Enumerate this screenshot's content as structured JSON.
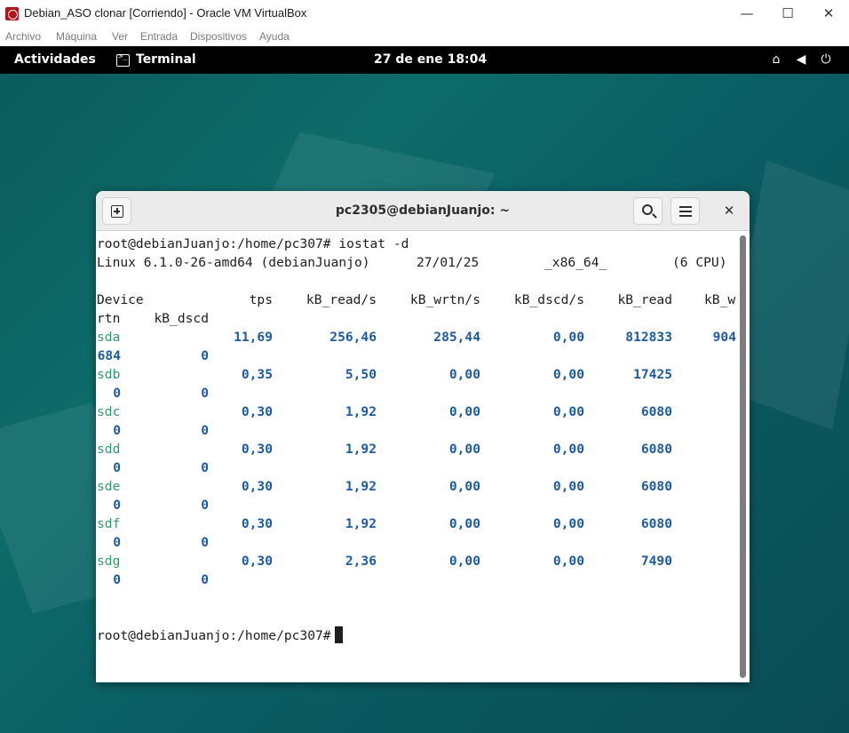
{
  "host_window": {
    "title": "Debian_ASO clonar [Corriendo] - Oracle VM VirtualBox",
    "app_icon": "virtualbox-icon",
    "controls": {
      "minimize": "—",
      "maximize": "☐",
      "close": "✕"
    },
    "menu": [
      "Archivo",
      "Máquina",
      "Ver",
      "Entrada",
      "Dispositivos",
      "Ayuda"
    ]
  },
  "gnome_bar": {
    "activities": "Actividades",
    "app_name": "Terminal",
    "clock": "27 de ene  18:04",
    "tray_icons": [
      "network-wired-icon",
      "volume-icon",
      "power-icon"
    ]
  },
  "terminal": {
    "title": "pc2305@debianJuanjo: ~",
    "icons": {
      "new_tab": "new-tab-icon",
      "search": "search-icon",
      "menu": "hamburger-menu-icon",
      "close": "close-icon"
    },
    "close_glyph": "✕",
    "command_line": "root@debianJuanjo:/home/pc307# iostat -d",
    "sysinfo": {
      "kernel": "Linux 6.1.0-26-amd64 (debianJuanjo)",
      "date": "27/01/25",
      "arch": "_x86_64_",
      "cpus": "(6 CPU)"
    },
    "header": {
      "device": "Device",
      "tps": "tps",
      "read_s": "kB_read/s",
      "wrtn_s": "kB_wrtn/s",
      "dscd_s": "kB_dscd/s",
      "read": "kB_read",
      "wrtn_cut": "kB_w",
      "wrtn_rest": "rtn",
      "dscd": "kB_dscd"
    },
    "rows": [
      {
        "device": "sda",
        "tps": "11,69",
        "read_s": "256,46",
        "wrtn_s": "285,44",
        "dscd_s": "0,00",
        "read": "812833",
        "wrtn_cut": "904",
        "wrtn_rest": "684",
        "dscd": "0"
      },
      {
        "device": "sdb",
        "tps": "0,35",
        "read_s": "5,50",
        "wrtn_s": "0,00",
        "dscd_s": "0,00",
        "read": "17425",
        "wrtn_cut": "",
        "wrtn_rest": "0",
        "dscd": "0"
      },
      {
        "device": "sdc",
        "tps": "0,30",
        "read_s": "1,92",
        "wrtn_s": "0,00",
        "dscd_s": "0,00",
        "read": "6080",
        "wrtn_cut": "",
        "wrtn_rest": "0",
        "dscd": "0"
      },
      {
        "device": "sdd",
        "tps": "0,30",
        "read_s": "1,92",
        "wrtn_s": "0,00",
        "dscd_s": "0,00",
        "read": "6080",
        "wrtn_cut": "",
        "wrtn_rest": "0",
        "dscd": "0"
      },
      {
        "device": "sde",
        "tps": "0,30",
        "read_s": "1,92",
        "wrtn_s": "0,00",
        "dscd_s": "0,00",
        "read": "6080",
        "wrtn_cut": "",
        "wrtn_rest": "0",
        "dscd": "0"
      },
      {
        "device": "sdf",
        "tps": "0,30",
        "read_s": "1,92",
        "wrtn_s": "0,00",
        "dscd_s": "0,00",
        "read": "6080",
        "wrtn_cut": "",
        "wrtn_rest": "0",
        "dscd": "0"
      },
      {
        "device": "sdg",
        "tps": "0,30",
        "read_s": "2,36",
        "wrtn_s": "0,00",
        "dscd_s": "0,00",
        "read": "7490",
        "wrtn_cut": "",
        "wrtn_rest": "0",
        "dscd": "0"
      }
    ],
    "prompt": "root@debianJuanjo:/home/pc307#"
  },
  "colors": {
    "device_name": "#2e9a6b",
    "numeric_value": "#1c5aa4",
    "gnome_bar": "#000000",
    "desktop": "#0d6c6a"
  }
}
